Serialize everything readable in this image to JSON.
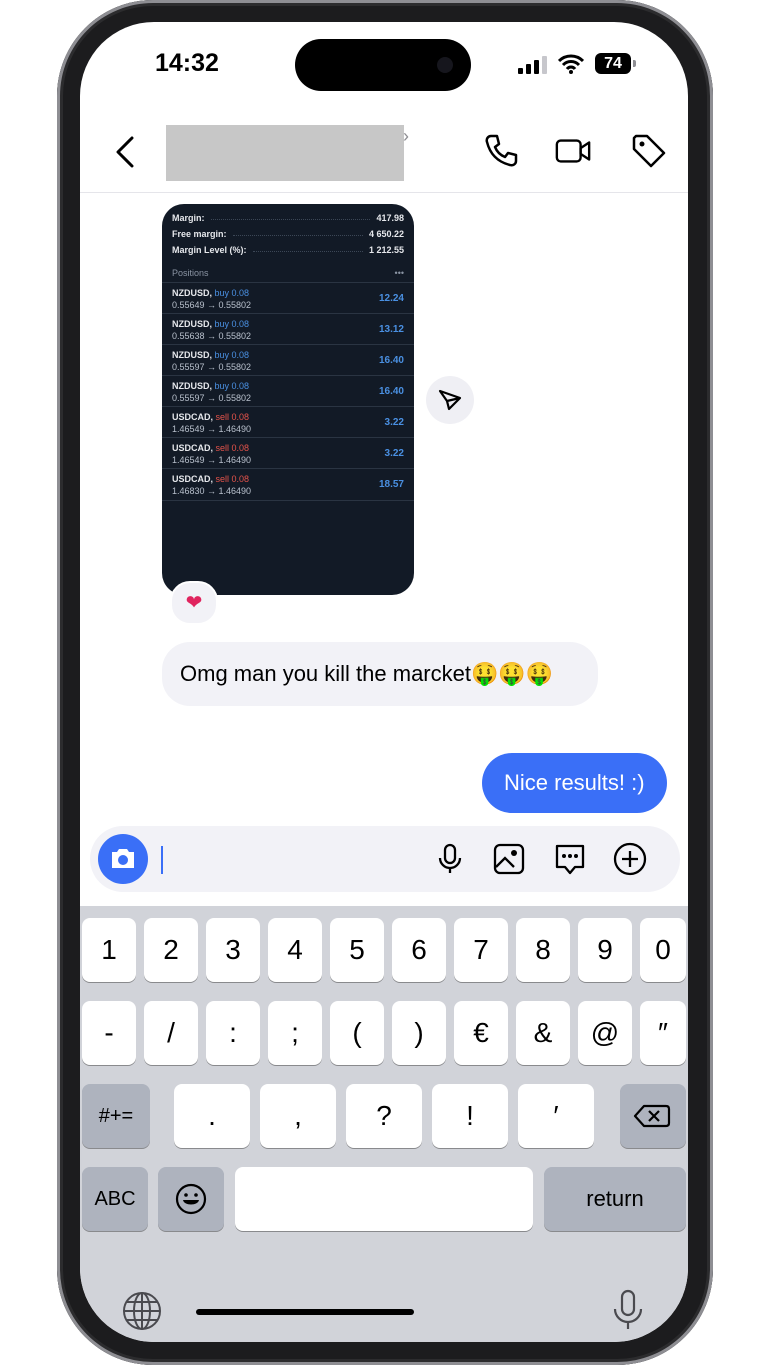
{
  "status": {
    "time": "14:32",
    "battery": "74"
  },
  "header": {
    "back_icon": "chevron-left-icon",
    "contact_name": "",
    "call_icon": "phone-icon",
    "video_icon": "video-icon",
    "tag_icon": "tag-icon"
  },
  "shared_image": {
    "summary": [
      {
        "label": "Margin:",
        "value": "417.98"
      },
      {
        "label": "Free margin:",
        "value": "4 650.22"
      },
      {
        "label": "Margin Level (%):",
        "value": "1 212.55"
      }
    ],
    "positions_label": "Positions",
    "positions_menu": "•••",
    "positions": [
      {
        "symbol": "NZDUSD,",
        "side": "buy 0.08",
        "range": "0.55649 → 0.55802",
        "profit": "12.24"
      },
      {
        "symbol": "NZDUSD,",
        "side": "buy 0.08",
        "range": "0.55638 → 0.55802",
        "profit": "13.12"
      },
      {
        "symbol": "NZDUSD,",
        "side": "buy 0.08",
        "range": "0.55597 → 0.55802",
        "profit": "16.40"
      },
      {
        "symbol": "NZDUSD,",
        "side": "buy 0.08",
        "range": "0.55597 → 0.55802",
        "profit": "16.40"
      },
      {
        "symbol": "USDCAD,",
        "side": "sell 0.08",
        "range": "1.46549 → 1.46490",
        "profit": "3.22"
      },
      {
        "symbol": "USDCAD,",
        "side": "sell 0.08",
        "range": "1.46549 → 1.46490",
        "profit": "3.22"
      },
      {
        "symbol": "USDCAD,",
        "side": "sell 0.08",
        "range": "1.46830 → 1.46490",
        "profit": "18.57"
      }
    ],
    "buy_color": "#4a90e2",
    "sell_color": "#e5534b"
  },
  "reaction": "❤",
  "messages": [
    {
      "direction": "incoming",
      "text": "Omg man you kill the marcket🤑🤑🤑"
    },
    {
      "direction": "outgoing",
      "text": "Nice results! :)"
    }
  ],
  "composer": {
    "value": "",
    "camera_icon": "camera-icon",
    "mic_icon": "microphone-icon",
    "gallery_icon": "image-icon",
    "sticker_icon": "message-dots-icon",
    "plus_icon": "plus-circle-icon"
  },
  "keyboard": {
    "row1": [
      "1",
      "2",
      "3",
      "4",
      "5",
      "6",
      "7",
      "8",
      "9",
      "0"
    ],
    "row2": [
      "-",
      "/",
      ":",
      ";",
      "(",
      ")",
      "€",
      "&",
      "@",
      "″"
    ],
    "row3": [
      ".",
      ",",
      "?",
      "!",
      "′"
    ],
    "symbols_key": "#+=",
    "abc_key": "ABC",
    "return_key": "return"
  },
  "accent_color": "#3a6ff7"
}
